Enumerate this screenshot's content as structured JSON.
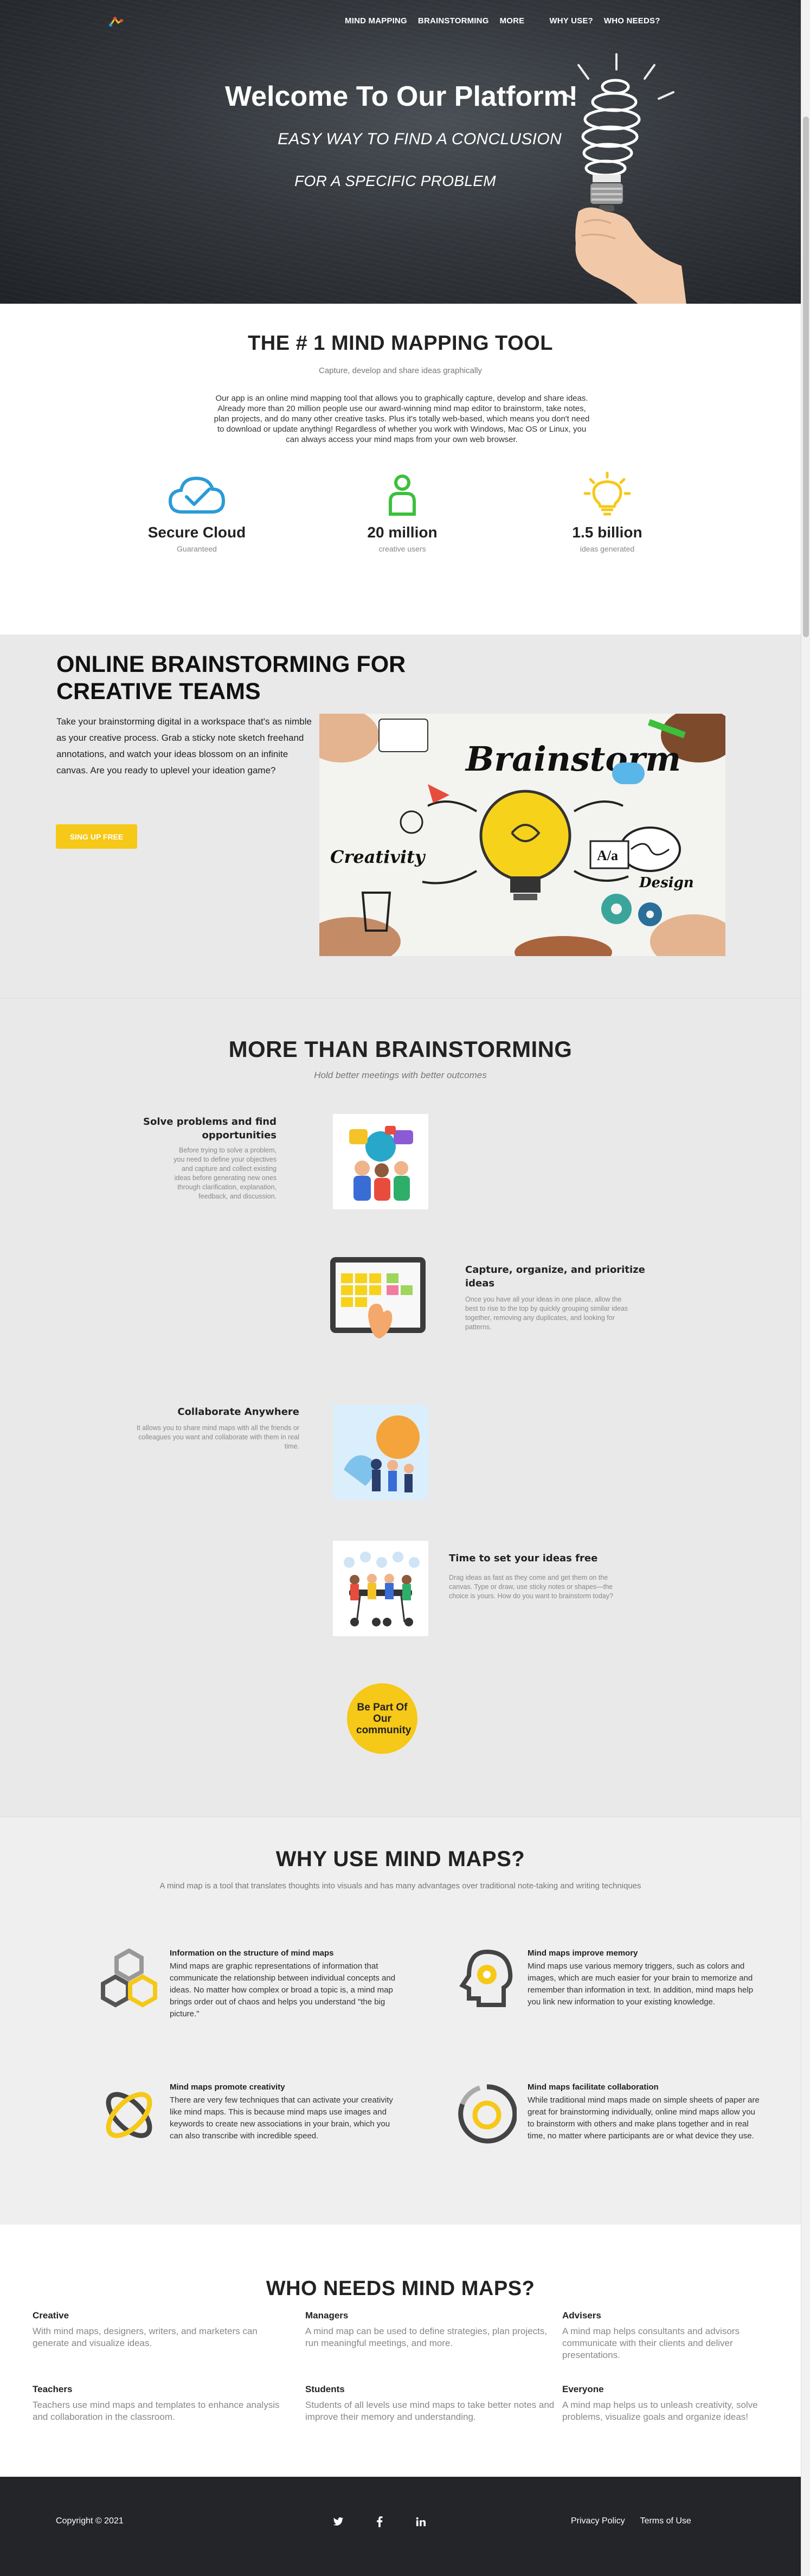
{
  "nav": {
    "items": [
      {
        "label": "MIND MAPPING"
      },
      {
        "label": "BRAINSTORMING"
      },
      {
        "label": "MORE"
      },
      {
        "label": "WHY USE?"
      },
      {
        "label": "WHO NEEDS?"
      }
    ]
  },
  "hero": {
    "title": "Welcome To Our Platform!",
    "subtitle1": "EASY WAY TO FIND A CONCLUSION",
    "subtitle2": "FOR A SPECIFIC PROBLEM"
  },
  "intro": {
    "title": "THE # 1 MIND MAPPING TOOL",
    "tagline": "Capture, develop and share ideas graphically",
    "body": "Our app is an online mind mapping tool that allows you to graphically capture, develop and share ideas. Already more than 20 million people use our award-winning mind map editor to brainstorm, take notes, plan projects, and do many other creative tasks. Plus it's totally web-based, which means you don't need to download or update anything! Regardless of whether you work with Windows, Mac OS or Linux, you can always access your mind maps from your own web browser.",
    "stats": [
      {
        "value": "Secure Cloud",
        "label": "Guaranteed",
        "icon": "cloud-check-icon"
      },
      {
        "value": "20 million",
        "label": "creative users",
        "icon": "user-icon"
      },
      {
        "value": "1.5 billion",
        "label": "ideas generated",
        "icon": "lightbulb-icon"
      }
    ]
  },
  "brainstorm": {
    "title": "ONLINE BRAINSTORMING FOR CREATIVE TEAMS",
    "body": "Take your brainstorming digital in a workspace that's as nimble as your creative process. Grab a sticky note sketch freehand annotations, and watch your ideas blossom on an infinite canvas. Are you ready to uplevel your ideation game?",
    "button": "SING UP FREE",
    "image_text": "Brainstorm",
    "image_words": [
      "Creativity",
      "Design"
    ],
    "image_aa": "A/a"
  },
  "more": {
    "title": "MORE THAN BRAINSTORMING",
    "subtitle": "Hold better meetings with better outcomes",
    "features": [
      {
        "title": "Solve problems and find opportunities",
        "desc": "Before trying to solve a problem, you need to define your objectives and capture and collect existing ideas before generating new ones through clarification, explanation, feedback, and discussion."
      },
      {
        "title": "Capture, organize, and prioritize ideas",
        "desc": "Once you have all your ideas in one place, allow the best to rise to the top by quickly grouping similar ideas together, removing any duplicates, and looking for patterns."
      },
      {
        "title": "Collaborate Anywhere",
        "desc": "It allows you to share mind maps with all the friends or colleagues you want and collaborate with them in real time."
      },
      {
        "title": "Time to set your ideas free",
        "desc": "Drag ideas as fast as they come and get them on the canvas. Type or draw, use sticky notes or shapes—the choice is yours. How do you want to brainstorm today?"
      }
    ],
    "badge": "Be Part Of Our community"
  },
  "why": {
    "title": "WHY USE MIND MAPS?",
    "subtitle": "A mind map is a tool that translates thoughts into visuals and has many advantages over traditional note-taking and writing techniques",
    "items": [
      {
        "title": "Information on the structure of mind maps",
        "text": "Mind maps are graphic representations of information that communicate the relationship between individual concepts and ideas. No matter how complex or broad a topic is, a mind map brings order out of chaos and helps you understand \"the big picture.\""
      },
      {
        "title": "Mind maps improve memory",
        "text": "Mind maps use various memory triggers, such as colors and images, which are much easier for your brain to memorize and remember than information in text. In addition, mind maps help you link new information to your existing knowledge."
      },
      {
        "title": "Mind maps promote creativity",
        "text": "There are very few techniques that can activate your creativity like mind maps. This is because mind maps use images and keywords to create new associations in your brain, which you can also transcribe with incredible speed."
      },
      {
        "title": "Mind maps facilitate collaboration",
        "text": "While traditional mind maps made on simple sheets of paper are great for brainstorming individually, online mind maps allow you to brainstorm with others and make plans together and in real time, no matter where participants are or what device they use."
      }
    ]
  },
  "who": {
    "title": "WHO NEEDS MIND MAPS?",
    "items": [
      {
        "title": "Creative",
        "text": "With mind maps, designers, writers, and marketers can generate and visualize ideas."
      },
      {
        "title": "Managers",
        "text": "A mind map can be used to define strategies, plan projects, run meaningful meetings, and more."
      },
      {
        "title": "Advisers",
        "text": "A mind map helps consultants and advisors communicate with their clients and deliver presentations."
      },
      {
        "title": "Teachers",
        "text": "Teachers use mind maps and templates to enhance analysis and collaboration in the classroom."
      },
      {
        "title": "Students",
        "text": "Students of all levels use mind maps to take better notes and improve their memory and understanding."
      },
      {
        "title": "Everyone",
        "text": "A mind map helps us to unleash creativity, solve problems, visualize goals and organize ideas!"
      }
    ]
  },
  "footer": {
    "copyright": "Copyright © 2021",
    "social": [
      "twitter-icon",
      "facebook-icon",
      "linkedin-icon"
    ],
    "links": [
      "Privacy Policy",
      "Terms of Use"
    ]
  },
  "colors": {
    "accent_yellow": "#f6c817",
    "accent_blue": "#2a9bd8",
    "accent_green": "#3cc03c",
    "footer_bg": "#232528",
    "section_grey": "#e9e9e9"
  }
}
